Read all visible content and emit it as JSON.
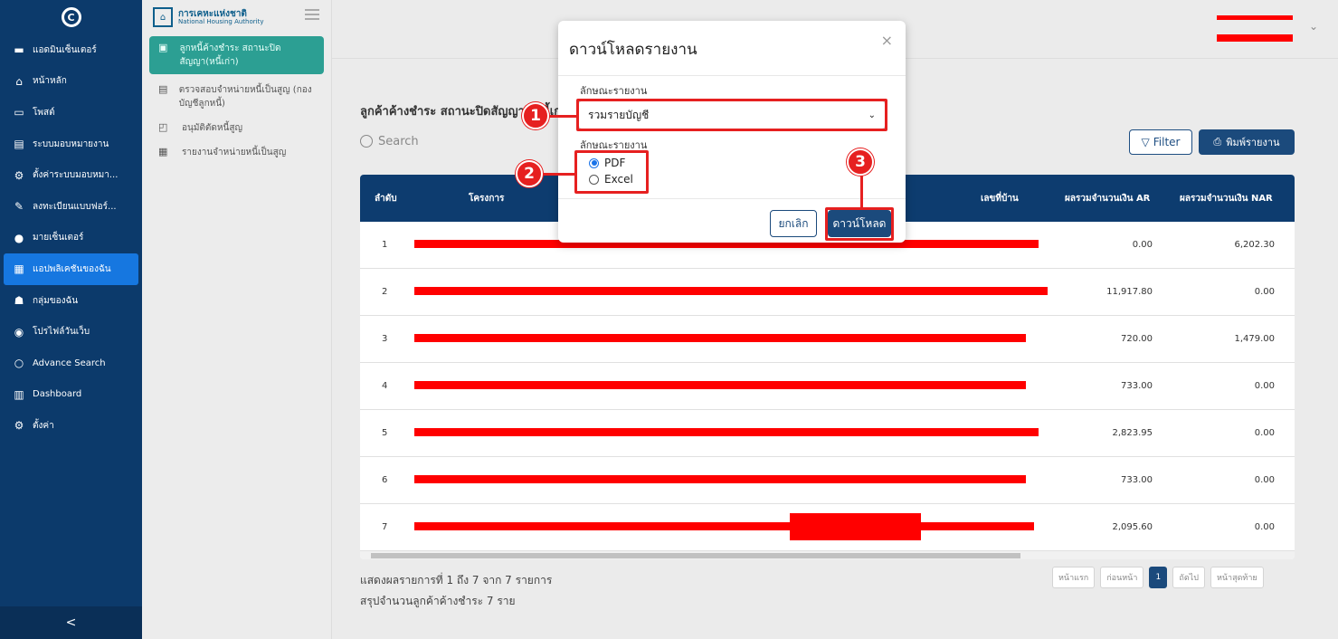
{
  "nav": {
    "items": [
      {
        "label": "แอดมินเซ็นเตอร์",
        "icon": "briefcase-icon"
      },
      {
        "label": "หน้าหลัก",
        "icon": "home-icon"
      },
      {
        "label": "โพสต์",
        "icon": "post-icon"
      },
      {
        "label": "ระบบมอบหมายงาน",
        "icon": "document-icon"
      },
      {
        "label": "ตั้งค่าระบบมอบหมา...",
        "icon": "gear-icon"
      },
      {
        "label": "ลงทะเบียนแบบฟอร์...",
        "icon": "form-icon"
      },
      {
        "label": "มายเซ็นเตอร์",
        "icon": "user-icon"
      },
      {
        "label": "แอปพลิเคชันของฉัน",
        "icon": "apps-icon"
      },
      {
        "label": "กลุ่มของฉัน",
        "icon": "group-icon"
      },
      {
        "label": "โปรไฟล์วันเว็บ",
        "icon": "profile-icon"
      },
      {
        "label": "Advance Search",
        "icon": "search-icon"
      },
      {
        "label": "Dashboard",
        "icon": "chart-icon"
      },
      {
        "label": "ตั้งค่า",
        "icon": "settings-icon"
      }
    ],
    "collapse": "<"
  },
  "subnav": {
    "org_name": "การเคหะแห่งชาติ",
    "org_name_en": "National Housing Authority",
    "items": [
      {
        "label": "ลูกหนี้ค้างชำระ สถานะปิดสัญญา(หนี้เก่า)"
      },
      {
        "label": "ตรวจสอบจำหน่ายหนี้เป็นสูญ (กองบัญชีลูกหนี้)"
      },
      {
        "label": "อนุมัติตัดหนี้สูญ"
      },
      {
        "label": "รายงานจำหน่ายหนี้เป็นสูญ"
      }
    ]
  },
  "main": {
    "title": "ลูกค้าค้างชำระ สถานะปิดสัญญา (หนี้เก่",
    "search_placeholder": "Search",
    "filter_label": "Filter",
    "print_label": "พิมพ์รายงาน",
    "columns": [
      "ลำดับ",
      "โครงการ",
      "เลขที่บ้าน",
      "ผลรวมจำนวนเงิน AR",
      "ผลรวมจำนวนเงิน NAR"
    ],
    "rows": [
      {
        "no": "1",
        "ar": "0.00",
        "nar": "6,202.30"
      },
      {
        "no": "2",
        "ar": "11,917.80",
        "nar": "0.00"
      },
      {
        "no": "3",
        "ar": "720.00",
        "nar": "1,479.00"
      },
      {
        "no": "4",
        "ar": "733.00",
        "nar": "0.00"
      },
      {
        "no": "5",
        "ar": "2,823.95",
        "nar": "0.00"
      },
      {
        "no": "6",
        "ar": "733.00",
        "nar": "0.00"
      },
      {
        "no": "7",
        "ar": "2,095.60",
        "nar": "0.00"
      }
    ],
    "footer_line1": "แสดงผลรายการที่ 1 ถึง 7 จาก 7 รายการ",
    "footer_line2": "สรุปจำนวนลูกค้าค้างชำระ 7 ราย",
    "pager": {
      "first": "หน้าแรก",
      "prev": "ก่อนหน้า",
      "current": "1",
      "next": "ถัดไป",
      "last": "หน้าสุดท้าย"
    }
  },
  "modal": {
    "title": "ดาวน์โหลดรายงาน",
    "close": "×",
    "report_label": "ลักษณะรายงาน",
    "report_value": "รวมรายบัญชี",
    "format_label": "ลักษณะรายงาน",
    "format_options": [
      "PDF",
      "Excel"
    ],
    "format_selected": "PDF",
    "cancel_label": "ยกเลิก",
    "download_label": "ดาวน์โหลด"
  },
  "steps": [
    "1",
    "2",
    "3"
  ],
  "colors": {
    "nav_bg": "#0c3a6b",
    "accent": "#1b4a7c",
    "active_sub": "#2c9f93",
    "annotation": "#e62020"
  }
}
